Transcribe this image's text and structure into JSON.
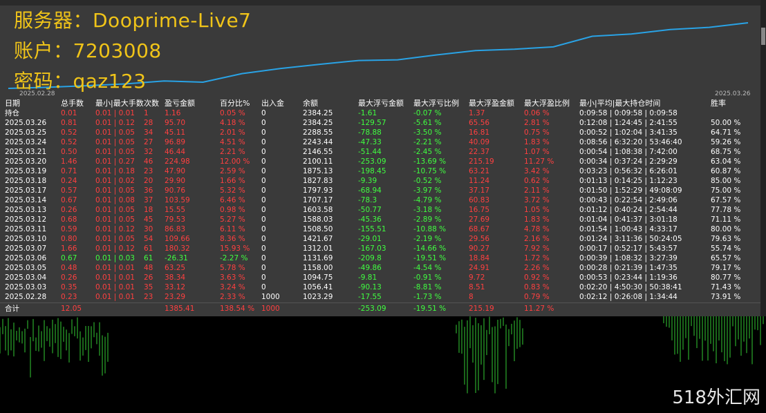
{
  "overlay": {
    "server": "服务器：Dooprime-Live7",
    "account": "账户：7203008",
    "password": "密码：qaz123"
  },
  "chart": {
    "start_date": "2025.02.28",
    "end_date": "2025.03.26"
  },
  "headers": [
    "日期",
    "总手数",
    "最小|最大手数",
    "次数",
    "盈亏金额",
    "百分比%",
    "出入金",
    "余额",
    "最大浮亏金额",
    "最大浮亏比例",
    "最大浮盈金额",
    "最大浮盈比例",
    "最小|平均|最大持仓时间",
    "胜率"
  ],
  "holding": {
    "label": "持仓",
    "lots": "0.01",
    "minmax": "0.01 | 0.01",
    "count": "1",
    "pl": "1.16",
    "pct": "0.05 %",
    "deposit": "0",
    "balance": "2384.25",
    "maxloss": "-1.61",
    "maxlosspct": "-0.07 %",
    "maxprofit": "1.37",
    "maxprofitpct": "0.06 %",
    "time": "0:09:58 | 0:09:58 | 0:09:58",
    "winrate": ""
  },
  "rows": [
    {
      "date": "2025.03.26",
      "lots": "0.81",
      "minmax": "0.01 | 0.12",
      "count": "28",
      "pl": "95.70",
      "pct": "4.18 %",
      "deposit": "0",
      "balance": "2384.25",
      "maxloss": "-129.57",
      "maxlosspct": "-5.61 %",
      "maxprofit": "65.56",
      "maxprofitpct": "2.81 %",
      "time": "0:12:08 | 1:24:45 | 2:41:55",
      "winrate": "50.00 %",
      "pos": true
    },
    {
      "date": "2025.03.25",
      "lots": "0.52",
      "minmax": "0.01 | 0.05",
      "count": "34",
      "pl": "45.11",
      "pct": "2.01 %",
      "deposit": "0",
      "balance": "2288.55",
      "maxloss": "-78.88",
      "maxlosspct": "-3.50 %",
      "maxprofit": "16.81",
      "maxprofitpct": "0.75 %",
      "time": "0:00:52 | 1:02:04 | 3:41:35",
      "winrate": "64.71 %",
      "pos": true
    },
    {
      "date": "2025.03.24",
      "lots": "0.52",
      "minmax": "0.01 | 0.05",
      "count": "27",
      "pl": "96.89",
      "pct": "4.51 %",
      "deposit": "0",
      "balance": "2243.44",
      "maxloss": "-47.33",
      "maxlosspct": "-2.21 %",
      "maxprofit": "40.09",
      "maxprofitpct": "1.83 %",
      "time": "0:08:56 | 6:32:20 | 53:46:40",
      "winrate": "59.26 %",
      "pos": true
    },
    {
      "date": "2025.03.21",
      "lots": "0.50",
      "minmax": "0.01 | 0.05",
      "count": "32",
      "pl": "46.44",
      "pct": "2.21 %",
      "deposit": "0",
      "balance": "2146.55",
      "maxloss": "-51.44",
      "maxlosspct": "-2.45 %",
      "maxprofit": "22.37",
      "maxprofitpct": "1.07 %",
      "time": "0:00:54 | 1:08:38 | 7:42:00",
      "winrate": "68.75 %",
      "pos": true
    },
    {
      "date": "2025.03.20",
      "lots": "1.46",
      "minmax": "0.01 | 0.27",
      "count": "46",
      "pl": "224.98",
      "pct": "12.00 %",
      "deposit": "0",
      "balance": "2100.11",
      "maxloss": "-253.09",
      "maxlosspct": "-13.69 %",
      "maxprofit": "215.19",
      "maxprofitpct": "11.27 %",
      "time": "0:00:34 | 0:37:24 | 2:29:29",
      "winrate": "63.04 %",
      "pos": true
    },
    {
      "date": "2025.03.19",
      "lots": "0.71",
      "minmax": "0.01 | 0.18",
      "count": "23",
      "pl": "47.90",
      "pct": "2.59 %",
      "deposit": "0",
      "balance": "1875.13",
      "maxloss": "-198.45",
      "maxlosspct": "-10.75 %",
      "maxprofit": "63.21",
      "maxprofitpct": "3.42 %",
      "time": "0:03:23 | 0:56:32 | 6:26:01",
      "winrate": "60.87 %",
      "pos": true
    },
    {
      "date": "2025.03.18",
      "lots": "0.24",
      "minmax": "0.01 | 0.02",
      "count": "20",
      "pl": "29.90",
      "pct": "1.66 %",
      "deposit": "0",
      "balance": "1827.83",
      "maxloss": "-9.39",
      "maxlosspct": "-0.52 %",
      "maxprofit": "11.24",
      "maxprofitpct": "0.62 %",
      "time": "0:01:13 | 0:14:25 | 1:12:23",
      "winrate": "85.00 %",
      "pos": true
    },
    {
      "date": "2025.03.17",
      "lots": "0.57",
      "minmax": "0.01 | 0.05",
      "count": "36",
      "pl": "90.76",
      "pct": "5.32 %",
      "deposit": "0",
      "balance": "1797.93",
      "maxloss": "-68.94",
      "maxlosspct": "-3.97 %",
      "maxprofit": "37.17",
      "maxprofitpct": "2.11 %",
      "time": "0:01:50 | 1:52:29 | 49:08:09",
      "winrate": "75.00 %",
      "pos": true
    },
    {
      "date": "2025.03.14",
      "lots": "0.67",
      "minmax": "0.01 | 0.08",
      "count": "37",
      "pl": "103.59",
      "pct": "6.46 %",
      "deposit": "0",
      "balance": "1707.17",
      "maxloss": "-78.3",
      "maxlosspct": "-4.79 %",
      "maxprofit": "60.83",
      "maxprofitpct": "3.72 %",
      "time": "0:00:43 | 0:22:54 | 2:49:06",
      "winrate": "67.57 %",
      "pos": true
    },
    {
      "date": "2025.03.13",
      "lots": "0.26",
      "minmax": "0.01 | 0.05",
      "count": "18",
      "pl": "15.55",
      "pct": "0.98 %",
      "deposit": "0",
      "balance": "1603.58",
      "maxloss": "-50.77",
      "maxlosspct": "-3.18 %",
      "maxprofit": "16.75",
      "maxprofitpct": "1.05 %",
      "time": "0:01:12 | 0:40:24 | 2:54:44",
      "winrate": "77.78 %",
      "pos": true
    },
    {
      "date": "2025.03.12",
      "lots": "0.68",
      "minmax": "0.01 | 0.05",
      "count": "45",
      "pl": "79.53",
      "pct": "5.27 %",
      "deposit": "0",
      "balance": "1588.03",
      "maxloss": "-45.36",
      "maxlosspct": "-2.89 %",
      "maxprofit": "27.69",
      "maxprofitpct": "1.83 %",
      "time": "0:01:04 | 0:41:37 | 3:01:18",
      "winrate": "71.11 %",
      "pos": true
    },
    {
      "date": "2025.03.11",
      "lots": "0.59",
      "minmax": "0.01 | 0.12",
      "count": "30",
      "pl": "86.83",
      "pct": "6.11 %",
      "deposit": "0",
      "balance": "1508.50",
      "maxloss": "-155.51",
      "maxlosspct": "-10.88 %",
      "maxprofit": "68.67",
      "maxprofitpct": "4.78 %",
      "time": "0:01:54 | 1:00:43 | 4:33:17",
      "winrate": "80.00 %",
      "pos": true
    },
    {
      "date": "2025.03.10",
      "lots": "0.80",
      "minmax": "0.01 | 0.05",
      "count": "54",
      "pl": "109.66",
      "pct": "8.36 %",
      "deposit": "0",
      "balance": "1421.67",
      "maxloss": "-29.01",
      "maxlosspct": "-2.19 %",
      "maxprofit": "29.56",
      "maxprofitpct": "2.16 %",
      "time": "0:01:24 | 3:11:36 | 50:24:05",
      "winrate": "79.63 %",
      "pos": true
    },
    {
      "date": "2025.03.07",
      "lots": "1.66",
      "minmax": "0.01 | 0.12",
      "count": "61",
      "pl": "180.32",
      "pct": "15.93 %",
      "deposit": "0",
      "balance": "1312.01",
      "maxloss": "-167.03",
      "maxlosspct": "-14.66 %",
      "maxprofit": "90.27",
      "maxprofitpct": "7.92 %",
      "time": "0:00:17 | 0:52:17 | 5:43:57",
      "winrate": "55.74 %",
      "pos": true
    },
    {
      "date": "2025.03.06",
      "lots": "0.67",
      "minmax": "0.01 | 0.03",
      "count": "61",
      "pl": "-26.31",
      "pct": "-2.27 %",
      "deposit": "0",
      "balance": "1131.69",
      "maxloss": "-209.8",
      "maxlosspct": "-19.51 %",
      "maxprofit": "18.84",
      "maxprofitpct": "1.72 %",
      "time": "0:00:39 | 1:08:32 | 3:27:39",
      "winrate": "65.57 %",
      "pos": false
    },
    {
      "date": "2025.03.05",
      "lots": "0.48",
      "minmax": "0.01 | 0.01",
      "count": "48",
      "pl": "63.25",
      "pct": "5.78 %",
      "deposit": "0",
      "balance": "1158.00",
      "maxloss": "-49.86",
      "maxlosspct": "-4.54 %",
      "maxprofit": "24.91",
      "maxprofitpct": "2.26 %",
      "time": "0:00:28 | 0:21:39 | 1:47:35",
      "winrate": "79.17 %",
      "pos": true
    },
    {
      "date": "2025.03.04",
      "lots": "0.26",
      "minmax": "0.01 | 0.01",
      "count": "26",
      "pl": "38.34",
      "pct": "3.63 %",
      "deposit": "0",
      "balance": "1094.75",
      "maxloss": "-9.81",
      "maxlosspct": "-0.91 %",
      "maxprofit": "9.72",
      "maxprofitpct": "0.92 %",
      "time": "0:00:53 | 0:23:44 | 1:19:36",
      "winrate": "80.77 %",
      "pos": true
    },
    {
      "date": "2025.03.03",
      "lots": "0.35",
      "minmax": "0.01 | 0.01",
      "count": "35",
      "pl": "33.12",
      "pct": "3.24 %",
      "deposit": "0",
      "balance": "1056.41",
      "maxloss": "-90.13",
      "maxlosspct": "-8.81 %",
      "maxprofit": "8.51",
      "maxprofitpct": "0.83 %",
      "time": "0:02:20 | 4:50:30 | 50:38:41",
      "winrate": "71.43 %",
      "pos": true
    },
    {
      "date": "2025.02.28",
      "lots": "0.23",
      "minmax": "0.01 | 0.01",
      "count": "23",
      "pl": "23.29",
      "pct": "2.33 %",
      "deposit": "1000",
      "balance": "1023.29",
      "maxloss": "-17.55",
      "maxlosspct": "-1.73 %",
      "maxprofit": "8",
      "maxprofitpct": "0.79 %",
      "time": "0:02:12 | 0:26:08 | 1:34:44",
      "winrate": "73.91 %",
      "pos": true
    }
  ],
  "total": {
    "label": "合计",
    "lots": "12.05",
    "pl": "1385.41",
    "pct": "138.54 %",
    "deposit": "1000",
    "maxloss": "-253.09",
    "maxlosspct": "-19.51 %",
    "maxprofit": "215.19",
    "maxprofitpct": "11.27 %"
  },
  "logo": "518外汇网",
  "colors": {
    "positive": "#ff4040",
    "negative": "#40ff40",
    "equity_line": "#29a3e6",
    "overlay_text": "#f0c419"
  }
}
